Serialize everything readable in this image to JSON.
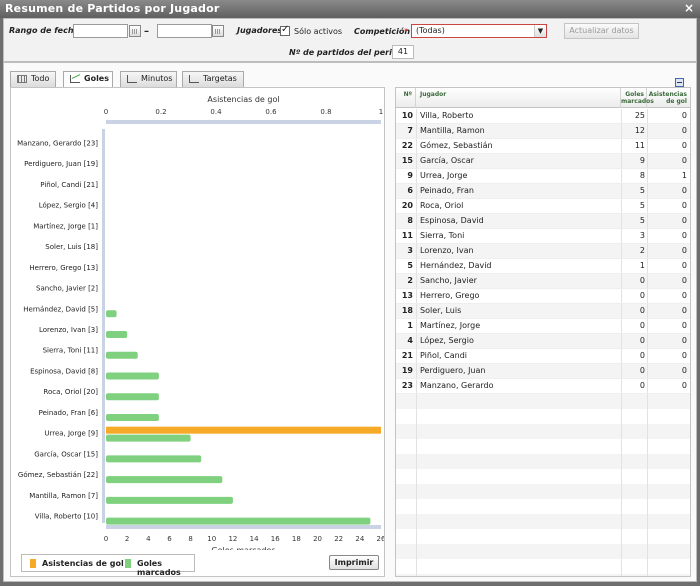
{
  "window": {
    "title": "Resumen de Partidos por Jugador",
    "close": "×"
  },
  "filters": {
    "date_range_label": "Rango de fechas",
    "date_from": "",
    "date_to": "",
    "date_separator": "–",
    "players_label": "Jugadores",
    "only_active_label": "Sólo activos",
    "only_active_checked": true,
    "competition_label": "Competición",
    "competition_required": "*",
    "competition_value": "(Todas)",
    "update_button": "Actualizar datos",
    "matches_label": "Nº de partidos del periodo",
    "matches_value": "41"
  },
  "tabs": [
    {
      "label": "Todo",
      "icon": "grid-icon",
      "active": false
    },
    {
      "label": "Goles",
      "icon": "line-chart-icon",
      "active": true
    },
    {
      "label": "Minutos",
      "icon": "chart-icon",
      "active": false
    },
    {
      "label": "Targetas",
      "icon": "chart-icon",
      "active": false
    }
  ],
  "legend": {
    "assists_label": "Asistencias de gol",
    "goals_label": "Goles marcados",
    "assists_color": "#f7a928",
    "goals_color": "#7fd17f"
  },
  "print_button": "Imprimir",
  "chart_data": {
    "type": "bar",
    "orientation": "horizontal",
    "top_axis": {
      "label": "Asistencias de gol",
      "range": [
        0,
        1
      ],
      "ticks": [
        "0",
        "0.2",
        "0.4",
        "0.6",
        "0.8",
        "1"
      ]
    },
    "bottom_axis": {
      "label": "Goles marcados",
      "range": [
        0,
        26
      ],
      "ticks": [
        "0",
        "2",
        "4",
        "6",
        "8",
        "10",
        "12",
        "14",
        "16",
        "18",
        "20",
        "22",
        "24",
        "26"
      ]
    },
    "categories": [
      "Manzano, Gerardo [23]",
      "Perdiguero, Juan [19]",
      "Piñol, Candi [21]",
      "López, Sergio [4]",
      "Martínez, Jorge [1]",
      "Soler, Luis [18]",
      "Herrero, Grego [13]",
      "Sancho, Javier [2]",
      "Hernández, David [5]",
      "Lorenzo, Ivan [3]",
      "Sierra, Toni [11]",
      "Espinosa, David [8]",
      "Roca, Oriol [20]",
      "Peinado, Fran [6]",
      "Urrea, Jorge [9]",
      "García, Oscar [15]",
      "Gómez, Sebastián [22]",
      "Mantilla, Ramon [7]",
      "Villa, Roberto [10]"
    ],
    "series": [
      {
        "name": "Asistencias de gol",
        "values": [
          0,
          0,
          0,
          0,
          0,
          0,
          0,
          0,
          0,
          0,
          0,
          0,
          0,
          0,
          1,
          0,
          0,
          0,
          0
        ]
      },
      {
        "name": "Goles marcados",
        "values": [
          0,
          0,
          0,
          0,
          0,
          0,
          0,
          0,
          1,
          2,
          3,
          5,
          5,
          5,
          8,
          9,
          11,
          12,
          25
        ]
      }
    ],
    "legend_position": "bottom-left"
  },
  "table": {
    "headers": {
      "number": "Nº",
      "player": "Jugador",
      "goals": "Goles marcados",
      "assists": "Asistencias de gol"
    },
    "rows": [
      {
        "number": "10",
        "player": "Villa, Roberto",
        "goals": "25",
        "assists": "0"
      },
      {
        "number": "7",
        "player": "Mantilla, Ramon",
        "goals": "12",
        "assists": "0"
      },
      {
        "number": "22",
        "player": "Gómez, Sebastián",
        "goals": "11",
        "assists": "0"
      },
      {
        "number": "15",
        "player": "García, Oscar",
        "goals": "9",
        "assists": "0"
      },
      {
        "number": "9",
        "player": "Urrea, Jorge",
        "goals": "8",
        "assists": "1"
      },
      {
        "number": "6",
        "player": "Peinado, Fran",
        "goals": "5",
        "assists": "0"
      },
      {
        "number": "20",
        "player": "Roca, Oriol",
        "goals": "5",
        "assists": "0"
      },
      {
        "number": "8",
        "player": "Espinosa, David",
        "goals": "5",
        "assists": "0"
      },
      {
        "number": "11",
        "player": "Sierra, Toni",
        "goals": "3",
        "assists": "0"
      },
      {
        "number": "3",
        "player": "Lorenzo, Ivan",
        "goals": "2",
        "assists": "0"
      },
      {
        "number": "5",
        "player": "Hernández, David",
        "goals": "1",
        "assists": "0"
      },
      {
        "number": "2",
        "player": "Sancho, Javier",
        "goals": "0",
        "assists": "0"
      },
      {
        "number": "13",
        "player": "Herrero, Grego",
        "goals": "0",
        "assists": "0"
      },
      {
        "number": "18",
        "player": "Soler, Luis",
        "goals": "0",
        "assists": "0"
      },
      {
        "number": "1",
        "player": "Martínez, Jorge",
        "goals": "0",
        "assists": "0"
      },
      {
        "number": "4",
        "player": "López, Sergio",
        "goals": "0",
        "assists": "0"
      },
      {
        "number": "21",
        "player": "Piñol, Candi",
        "goals": "0",
        "assists": "0"
      },
      {
        "number": "19",
        "player": "Perdiguero, Juan",
        "goals": "0",
        "assists": "0"
      },
      {
        "number": "23",
        "player": "Manzano, Gerardo",
        "goals": "0",
        "assists": "0"
      }
    ]
  }
}
